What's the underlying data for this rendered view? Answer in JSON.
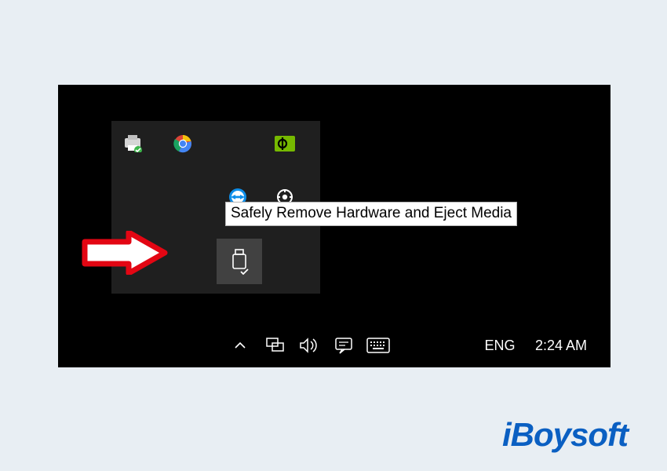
{
  "tooltip": {
    "safely_remove": "Safely Remove Hardware and Eject Media"
  },
  "flyout_icons": {
    "printer": "printer-check",
    "chrome": "chrome",
    "nvidia": "nvidia",
    "teamviewer": "teamviewer",
    "settings": "settings-sync",
    "safely_remove": "usb-eject"
  },
  "taskbar": {
    "chevron": "^",
    "network": "network",
    "volume": "volume",
    "action_center": "action-center",
    "keyboard": "touch-keyboard",
    "language": "ENG",
    "clock": "2:24 AM"
  },
  "brand": "iBoysoft"
}
